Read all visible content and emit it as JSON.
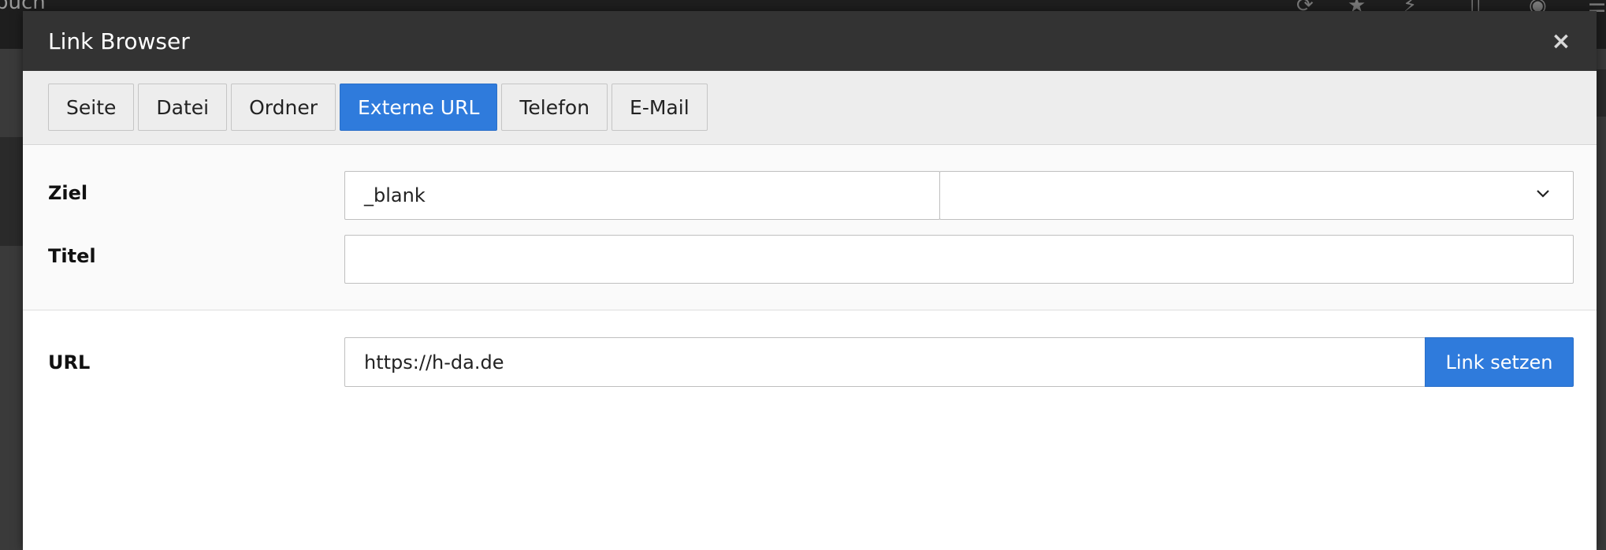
{
  "background": {
    "title_fragment": "buch"
  },
  "modal": {
    "title": "Link Browser",
    "close_glyph": "×"
  },
  "tabs": [
    {
      "label": "Seite",
      "active": false
    },
    {
      "label": "Datei",
      "active": false
    },
    {
      "label": "Ordner",
      "active": false
    },
    {
      "label": "Externe URL",
      "active": true
    },
    {
      "label": "Telefon",
      "active": false
    },
    {
      "label": "E-Mail",
      "active": false
    }
  ],
  "form": {
    "target_label": "Ziel",
    "target_value": "_blank",
    "target_select_value": "",
    "title_label": "Titel",
    "title_value": "",
    "url_label": "URL",
    "url_value": "https://h-da.de",
    "submit_label": "Link setzen"
  },
  "colors": {
    "accent": "#2f7bdc",
    "header": "#333333"
  }
}
